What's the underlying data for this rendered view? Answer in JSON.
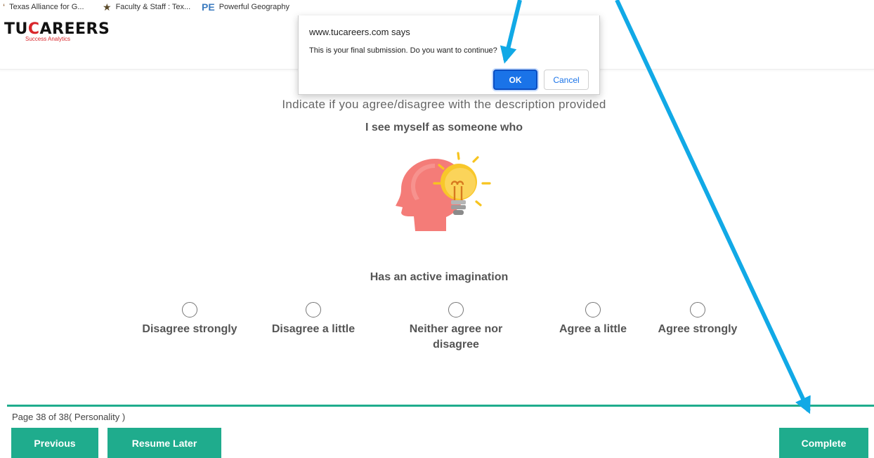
{
  "bookmarks": [
    {
      "label": "Texas Alliance for G...",
      "icon": "texas-icon"
    },
    {
      "label": "Faculty & Staff : Tex...",
      "icon": "star-icon"
    },
    {
      "label": "Powerful Geography",
      "icon": "pg-logo-icon"
    }
  ],
  "site": {
    "logo_text_a": "TU",
    "logo_text_b": "C",
    "logo_text_c": "AREERS",
    "logo_tagline": "Success Analytics"
  },
  "dialog": {
    "title": "www.tucareers.com says",
    "message": "This is your final submission. Do you want to continue?",
    "ok_label": "OK",
    "cancel_label": "Cancel"
  },
  "question": {
    "instruction": "Indicate if you agree/disagree with the description provided",
    "lead": "I see myself as someone who",
    "illustration": "head-lightbulb-icon",
    "statement": "Has an active imagination",
    "options": [
      {
        "label": "Disagree strongly"
      },
      {
        "label": "Disagree a little"
      },
      {
        "label": "Neither agree nor disagree"
      },
      {
        "label": "Agree a little"
      },
      {
        "label": "Agree strongly"
      }
    ]
  },
  "footer": {
    "page_info": "Page 38 of 38( Personality )",
    "previous_label": "Previous",
    "resume_label": "Resume Later",
    "complete_label": "Complete"
  },
  "colors": {
    "accent": "#1fac8d",
    "brand_red": "#d9262b",
    "dialog_primary": "#1a73e8",
    "annotation_arrow": "#11a9e6"
  }
}
